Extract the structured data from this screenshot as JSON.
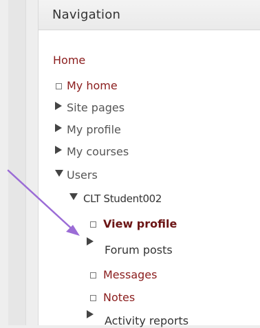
{
  "block": {
    "title": "Navigation"
  },
  "nav": {
    "home": "Home",
    "my_home": "My home",
    "site_pages": "Site pages",
    "my_profile": "My profile",
    "my_courses": "My courses",
    "users": "Users",
    "student": "CLT Student002",
    "view_profile": "View profile",
    "forum_posts": "Forum posts",
    "messages": "Messages",
    "notes": "Notes",
    "activity_reports": "Activity reports"
  },
  "colors": {
    "link": "#8a1c1c",
    "annotation_arrow": "#9b6cd6"
  }
}
